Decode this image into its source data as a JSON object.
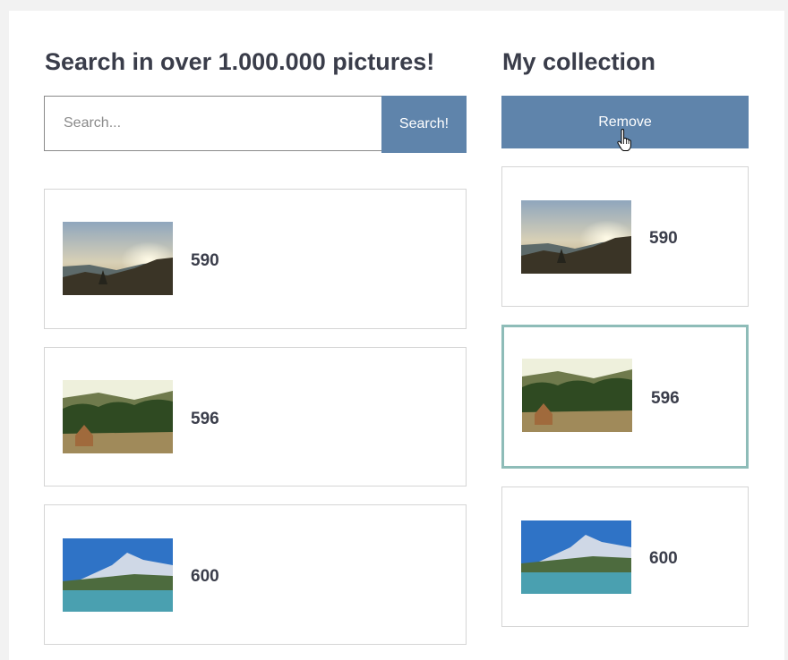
{
  "search": {
    "heading": "Search in over 1.000.000 pictures!",
    "placeholder": "Search...",
    "button_label": "Search!",
    "results": [
      {
        "id": "590",
        "thumbnail": "sunset-valley"
      },
      {
        "id": "596",
        "thumbnail": "cabin-forest"
      },
      {
        "id": "600",
        "thumbnail": "mountain-lake"
      }
    ]
  },
  "collection": {
    "heading": "My collection",
    "remove_label": "Remove",
    "items": [
      {
        "id": "590",
        "thumbnail": "sunset-valley"
      },
      {
        "id": "596",
        "thumbnail": "cabin-forest",
        "selected": true
      },
      {
        "id": "600",
        "thumbnail": "mountain-lake"
      }
    ]
  },
  "colors": {
    "accent": "#5f84ab",
    "selected_border": "#8ebcb8",
    "text": "#3a3d4a"
  },
  "icons": {
    "cursor": "hand-pointer-icon"
  }
}
